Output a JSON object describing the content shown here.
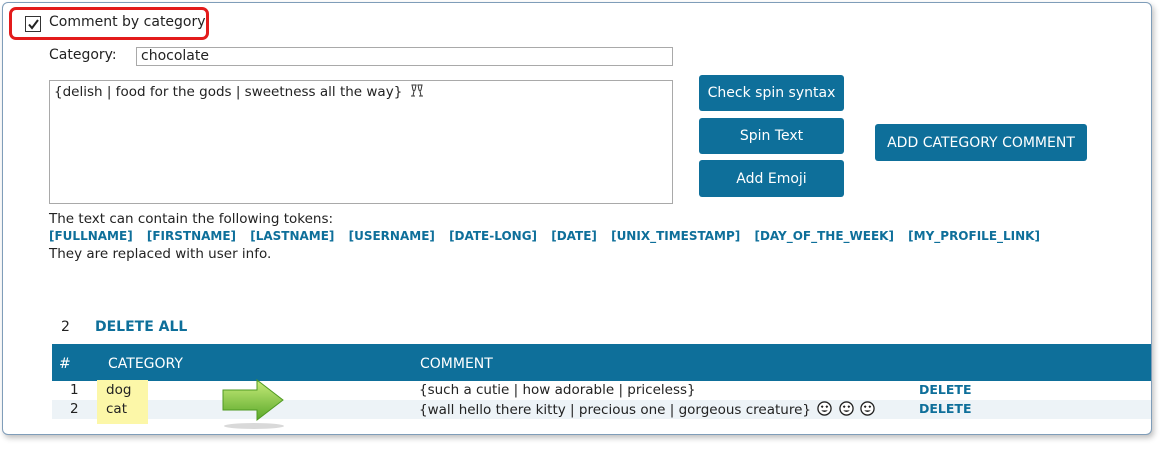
{
  "header": {
    "checkbox_label": "Comment by category",
    "checkbox_checked": true
  },
  "form": {
    "category_label": "Category:",
    "category_value": "chocolate",
    "comment_value": "{delish | food for the gods | sweetness all the way}",
    "comment_emoji": "clinking-glasses-icon"
  },
  "buttons": {
    "check_spin": "Check spin syntax",
    "spin_text": "Spin Text",
    "add_emoji": "Add Emoji",
    "add_category_comment": "ADD CATEGORY COMMENT"
  },
  "tokens": {
    "intro": "The text can contain the following tokens:",
    "items": [
      "[FULLNAME]",
      "[FIRSTNAME]",
      "[LASTNAME]",
      "[USERNAME]",
      "[DATE-LONG]",
      "[DATE]",
      "[UNIX_TIMESTAMP]",
      "[DAY_OF_THE_WEEK]",
      "[MY_PROFILE_LINK]"
    ],
    "outro": "They are replaced with user info."
  },
  "list": {
    "count": "2",
    "delete_all": "DELETE ALL",
    "columns": [
      "#",
      "CATEGORY",
      "COMMENT"
    ],
    "rows": [
      {
        "index": "1",
        "category": "dog",
        "comment": "{such a cutie | how adorable | priceless}",
        "emoji_count": 0,
        "action": "DELETE"
      },
      {
        "index": "2",
        "category": "cat",
        "comment": "{wall hello there kitty  | precious one | gorgeous creature}",
        "emoji_count": 3,
        "action": "DELETE"
      }
    ]
  },
  "colors": {
    "accent": "#0e6f9a",
    "callout_border": "#e31b1b",
    "category_highlight": "#fcf7a8",
    "arrow": "#7cc034"
  }
}
